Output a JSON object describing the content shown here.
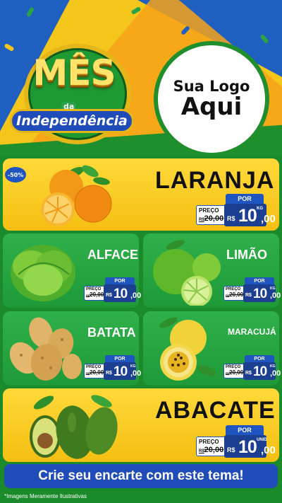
{
  "header": {
    "title_main": "MÊS",
    "title_da": "da",
    "title_sub": "Independência",
    "brand_line1": "Sua Logo",
    "brand_line2": "Aqui"
  },
  "featured_top": {
    "discount": "-50%",
    "name": "LARANJA",
    "por_label": "POR",
    "preco_label": "PREÇO",
    "old_prefix": "R$",
    "old_price": "20,00",
    "currency": "R$",
    "price_int": "10",
    "price_dec": ",00",
    "unit": "KG",
    "icon": "orange-fruit-icon"
  },
  "grid": [
    {
      "name": "ALFACE",
      "por_label": "POR",
      "preco_label": "PREÇO",
      "old_prefix": "R$",
      "old_price": "20,00",
      "currency": "R$",
      "price_int": "10",
      "price_dec": ",00",
      "unit": "",
      "icon": "lettuce-icon"
    },
    {
      "name": "LIMÃO",
      "por_label": "POR",
      "preco_label": "PREÇO",
      "old_prefix": "R$",
      "old_price": "20,00",
      "currency": "R$",
      "price_int": "10",
      "price_dec": ",00",
      "unit": "KG",
      "icon": "lime-icon"
    },
    {
      "name": "BATATA",
      "por_label": "POR",
      "preco_label": "PREÇO",
      "old_prefix": "R$",
      "old_price": "20,00",
      "currency": "R$",
      "price_int": "10",
      "price_dec": ",00",
      "unit": "KG",
      "icon": "potato-icon"
    },
    {
      "name": "MARACUJÁ",
      "por_label": "POR",
      "preco_label": "PREÇO",
      "old_prefix": "R$",
      "old_price": "20,00",
      "currency": "R$",
      "price_int": "10",
      "price_dec": ",00",
      "unit": "KG",
      "icon": "passion-fruit-icon"
    }
  ],
  "featured_bottom": {
    "name": "ABACATE",
    "por_label": "POR",
    "preco_label": "PREÇO",
    "old_prefix": "R$",
    "old_price": "20,00",
    "currency": "R$",
    "price_int": "10",
    "price_dec": ",00",
    "unit": "UNID",
    "icon": "avocado-icon"
  },
  "cta": "Crie seu encarte com este tema!",
  "footer": "*Imagens Meramente Ilustrativas",
  "colors": {
    "blue": "#1f55c0",
    "navy": "#1d3f91",
    "yellow": "#f5bf12",
    "green": "#1e9a38"
  }
}
